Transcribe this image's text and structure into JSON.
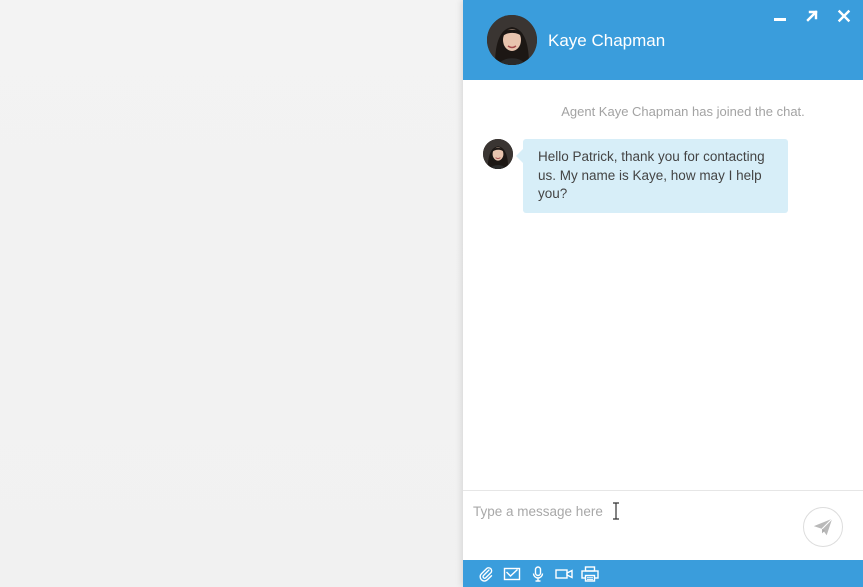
{
  "header": {
    "agent_name": "Kaye Chapman"
  },
  "window_controls": {
    "icons": [
      "minimize-icon",
      "maximize-icon",
      "close-icon"
    ]
  },
  "conversation": {
    "system_message": "Agent Kaye Chapman has joined the chat.",
    "messages": [
      {
        "sender": "agent",
        "text": "Hello Patrick, thank you for contacting us. My name is Kaye, how may I help you?"
      }
    ]
  },
  "composer": {
    "placeholder": "Type a message here"
  },
  "toolbar": {
    "icons": [
      "paperclip-icon",
      "email-icon",
      "microphone-icon",
      "video-camera-icon",
      "printer-icon"
    ]
  },
  "colors": {
    "brand_blue": "#3a9ddc",
    "bubble_bg": "#d7eef8",
    "system_text": "#a3a3a3"
  }
}
